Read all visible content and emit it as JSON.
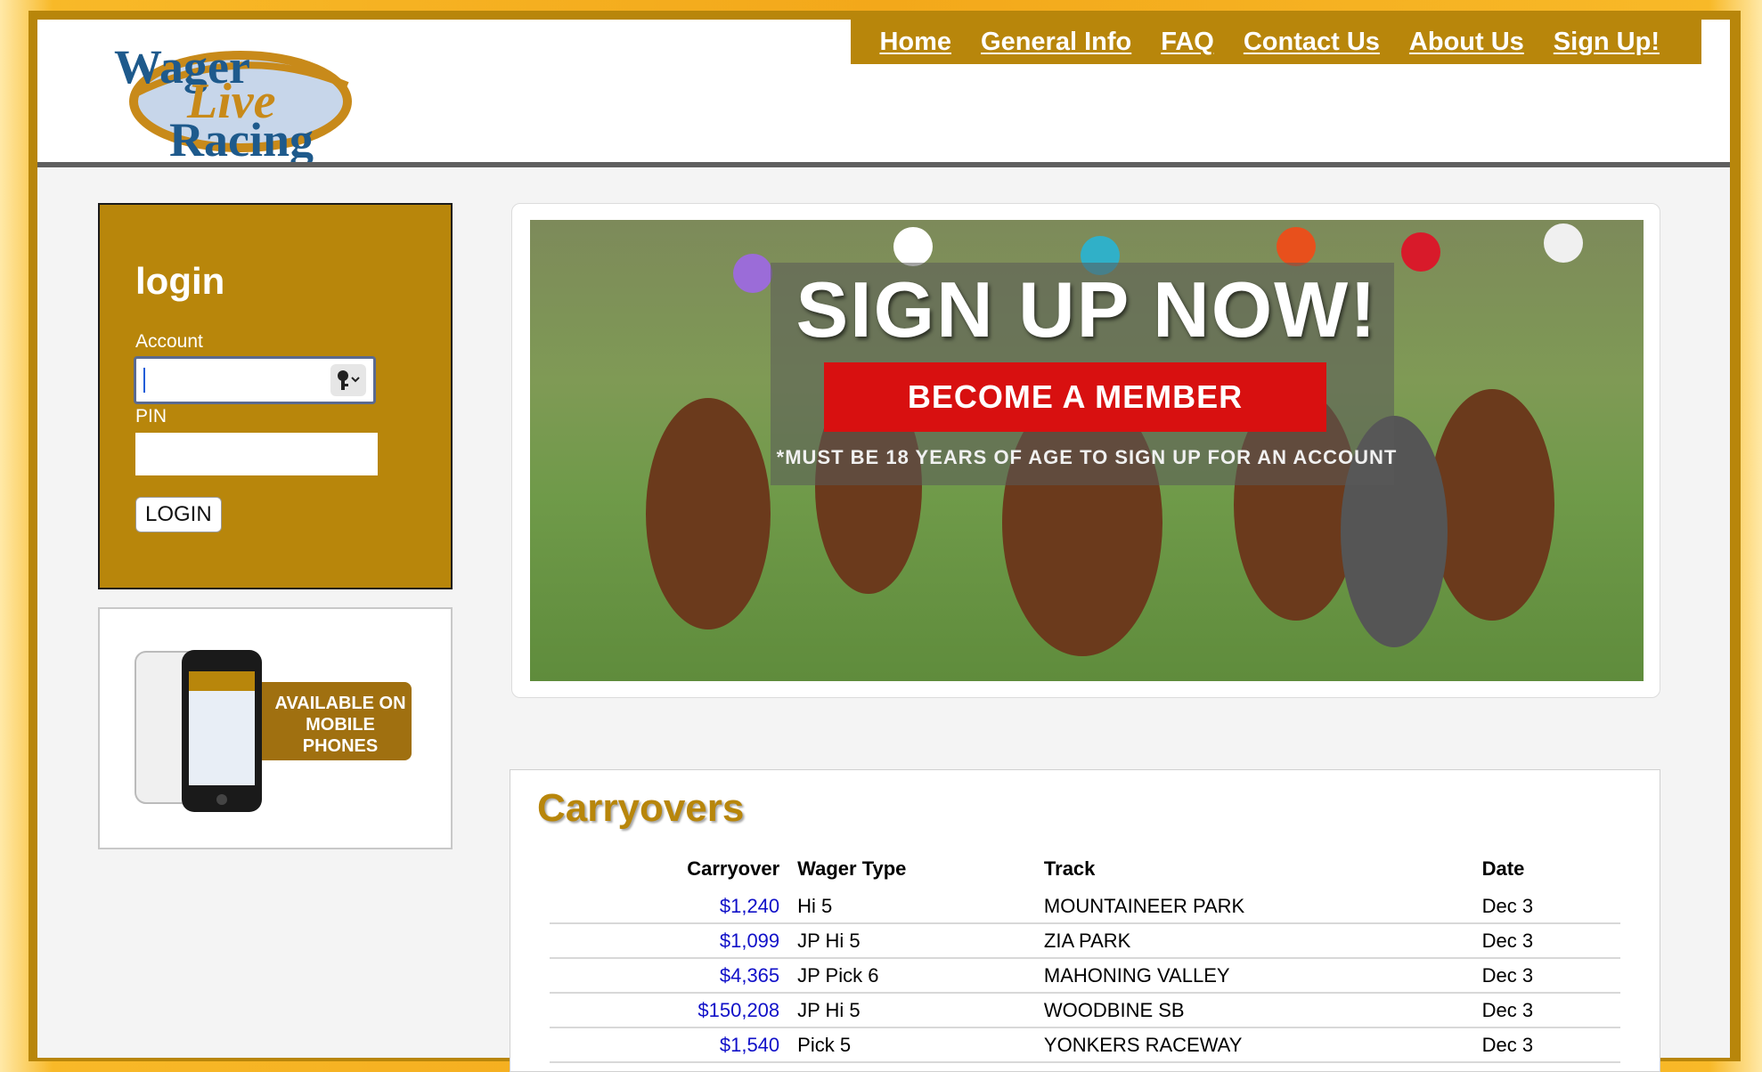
{
  "logo": {
    "line1": "Wager",
    "line2": "Live",
    "line3": "Racing"
  },
  "nav": {
    "items": [
      "Home",
      "General Info",
      "FAQ",
      "Contact Us",
      "About Us",
      "Sign Up!"
    ]
  },
  "login": {
    "title": "login",
    "account_label": "Account",
    "account_value": "",
    "pin_label": "PIN",
    "pin_value": "",
    "button_label": "LOGIN"
  },
  "mobile": {
    "line1": "AVAILABLE ON",
    "line2": "MOBILE",
    "line3": "PHONES"
  },
  "banner": {
    "title": "SIGN UP NOW!",
    "button_label": "BECOME A MEMBER",
    "note": "*MUST BE 18 YEARS OF AGE TO SIGN UP FOR AN ACCOUNT"
  },
  "carryovers": {
    "title": "Carryovers",
    "headers": [
      "Carryover",
      "Wager Type",
      "Track",
      "Date"
    ],
    "rows": [
      [
        "$1,240",
        "Hi 5",
        "MOUNTAINEER PARK",
        "Dec 3"
      ],
      [
        "$1,099",
        "JP Hi 5",
        "ZIA PARK",
        "Dec 3"
      ],
      [
        "$4,365",
        "JP Pick 6",
        "MAHONING VALLEY",
        "Dec 3"
      ],
      [
        "$150,208",
        "JP Hi 5",
        "WOODBINE SB",
        "Dec 3"
      ],
      [
        "$1,540",
        "Pick 5",
        "YONKERS RACEWAY",
        "Dec 3"
      ]
    ]
  },
  "colors": {
    "brand_gold": "#b8860b",
    "link_blue": "#1010c8",
    "banner_red": "#d81010"
  }
}
